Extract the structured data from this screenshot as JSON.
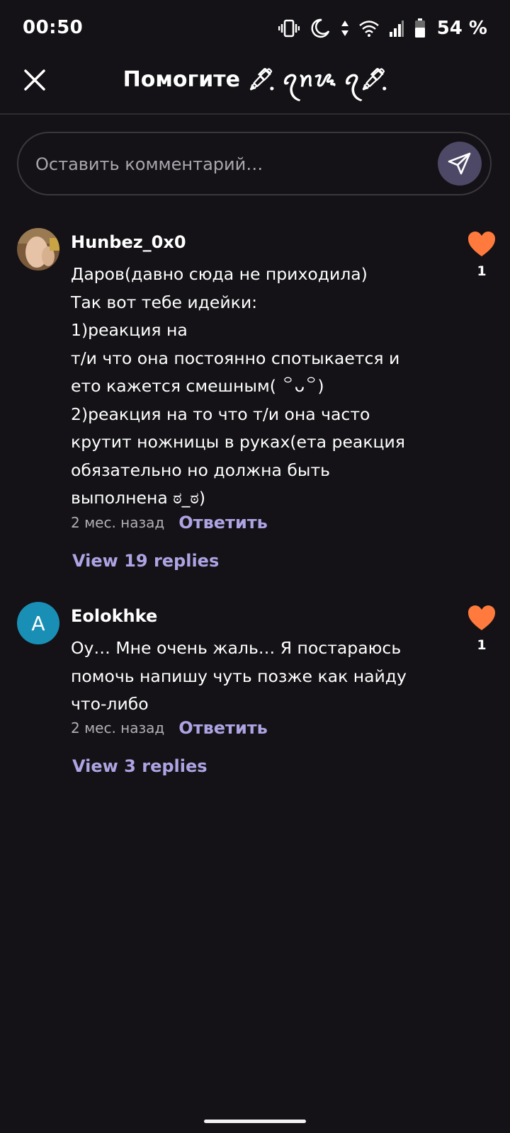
{
  "status_bar": {
    "time": "00:50",
    "battery": "54 %",
    "icons": [
      "vibrate-icon",
      "do-not-disturb-moon-icon",
      "data-arrows-icon",
      "wifi-icon",
      "signal-icon",
      "battery-icon"
    ]
  },
  "header": {
    "title": "Помогите 🖋ฺ︎ ︎ꪖ︎ꪀ︎ᝰ ꪖ︎🖋ฺ︎",
    "close_icon": "close-icon"
  },
  "comment_input": {
    "placeholder": "Оставить комментарий…",
    "send_icon": "send-icon"
  },
  "colors": {
    "background": "#141216",
    "accent": "#aea4e4",
    "like": "#ff7a3c",
    "send_button": "#4d4866"
  },
  "comments": [
    {
      "username": "Hunbez_0x0",
      "avatar": "photo",
      "lines": [
        "Даров(давно сюда не приходила)",
        "Так вот тебе идейки:",
        "1)реакция на",
        "т/и что она постоянно спотыкается и",
        "ето кажется смешным( ꒪ᴗ꒪)",
        "2)реакция на то что т/и она часто",
        "крутит ножницы в руках(ета реакция",
        "обязательно но должна быть",
        "выполнена ಠ_ಠ)"
      ],
      "timestamp": "2 мес. назад",
      "reply_label": "Ответить",
      "replies_label": "View 19 replies",
      "likes": "1"
    },
    {
      "username": "Eolokhke",
      "avatar_letter": "A",
      "lines": [
        "Оу… Мне очень жаль… Я постараюсь",
        "помочь напишу чуть позже как найду",
        "что-либо"
      ],
      "timestamp": "2 мес. назад",
      "reply_label": "Ответить",
      "replies_label": "View 3 replies",
      "likes": "1"
    }
  ]
}
